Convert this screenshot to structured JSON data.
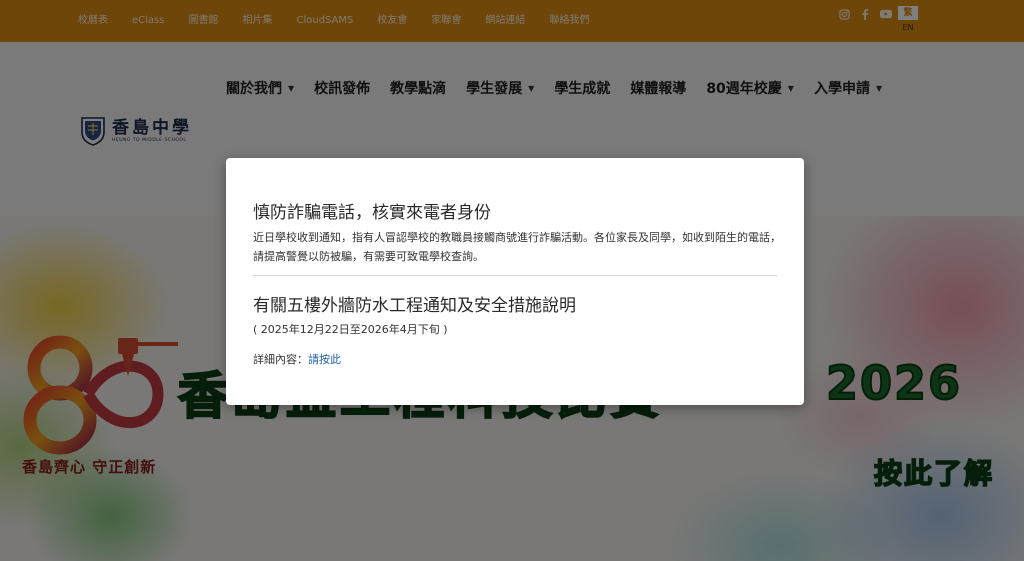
{
  "topbar": {
    "links": [
      "校曆表",
      "eClass",
      "圖書館",
      "相片集",
      "CloudSAMS",
      "校友會",
      "家聯會",
      "網站連結",
      "聯絡我們"
    ],
    "social_icons": [
      "instagram-icon",
      "facebook-icon",
      "youtube-icon"
    ],
    "lang_zh": "繁",
    "lang_en": "EN"
  },
  "header": {
    "logo_cn": "香島中學",
    "logo_en": "HEUNG TO MIDDLE SCHOOL",
    "nav": [
      {
        "label": "關於我們",
        "dropdown": true
      },
      {
        "label": "校訊發佈",
        "dropdown": false
      },
      {
        "label": "教學點滴",
        "dropdown": false
      },
      {
        "label": "學生發展",
        "dropdown": true
      },
      {
        "label": "學生成就",
        "dropdown": false
      },
      {
        "label": "媒體報導",
        "dropdown": false
      },
      {
        "label": "80週年校慶",
        "dropdown": true
      },
      {
        "label": "入學申請",
        "dropdown": true
      }
    ]
  },
  "banner": {
    "slogan": "香島齊心 守正創新",
    "title": "香島盃工程科技比賽",
    "year": "2026",
    "cta": "按此了解"
  },
  "modal": {
    "notice1_title": "慎防詐騙電話，核實來電者身份",
    "notice1_body": "近日學校收到通知，指有人冒認學校的教職員接觸商號進行詐騙活動。各位家長及同學，如收到陌生的電話，請提高警覺以防被騙，有需要可致電學校查詢。",
    "notice2_title": "有關五樓外牆防水工程通知及安全措施說明",
    "notice2_period": "( 2025年12月22日至2026年4月下旬 )",
    "notice2_detail_label": "詳細內容：",
    "notice2_detail_link": "請按此"
  },
  "colors": {
    "topbar": "#dd8c14",
    "header_bg": "#f5f5f5",
    "link": "#1f5fa8",
    "banner_green": "#1a6a2a"
  }
}
